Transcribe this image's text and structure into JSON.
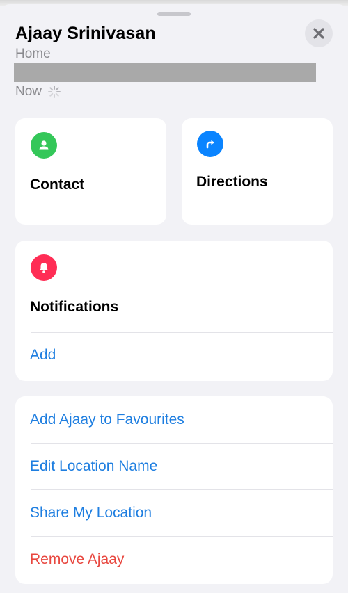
{
  "header": {
    "name": "Ajaay Srinivasan",
    "location_label": "Home",
    "time_label": "Now"
  },
  "actions": {
    "contact_label": "Contact",
    "directions_label": "Directions"
  },
  "notifications": {
    "title": "Notifications",
    "add_label": "Add"
  },
  "list": {
    "items": [
      {
        "label": "Add Ajaay to Favourites"
      },
      {
        "label": "Edit Location Name"
      },
      {
        "label": "Share My Location"
      },
      {
        "label": "Remove Ajaay"
      }
    ]
  },
  "colors": {
    "accent_blue": "#1e7ee0",
    "contact_green": "#34c759",
    "directions_blue": "#0a84ff",
    "notification_pink": "#ff2d55",
    "destructive_red": "#ff3b30"
  }
}
